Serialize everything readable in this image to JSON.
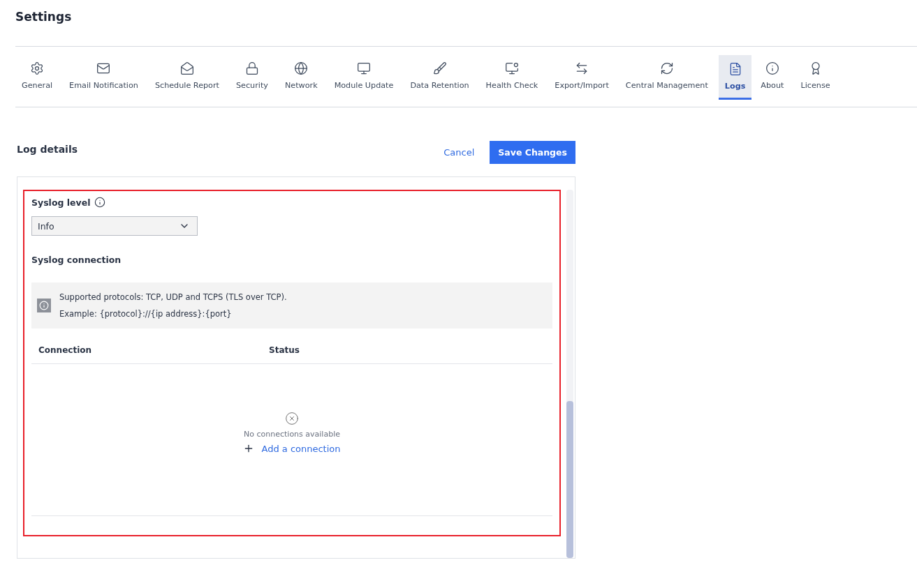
{
  "page": {
    "title": "Settings"
  },
  "tabs": [
    {
      "label": "General",
      "selected": false
    },
    {
      "label": "Email Notification",
      "selected": false
    },
    {
      "label": "Schedule Report",
      "selected": false
    },
    {
      "label": "Security",
      "selected": false
    },
    {
      "label": "Network",
      "selected": false
    },
    {
      "label": "Module Update",
      "selected": false
    },
    {
      "label": "Data Retention",
      "selected": false
    },
    {
      "label": "Health Check",
      "selected": false
    },
    {
      "label": "Export/Import",
      "selected": false
    },
    {
      "label": "Central Management",
      "selected": false
    },
    {
      "label": "Logs",
      "selected": true
    },
    {
      "label": "About",
      "selected": false
    },
    {
      "label": "License",
      "selected": false
    }
  ],
  "section": {
    "title": "Log details",
    "cancel": "Cancel",
    "save": "Save Changes"
  },
  "syslog_level": {
    "label": "Syslog level",
    "value": "Info"
  },
  "syslog_connection": {
    "label": "Syslog connection",
    "info": [
      "Supported protocols: TCP, UDP and TCPS (TLS over TCP).",
      "Example: {protocol}://{ip address}:{port}"
    ]
  },
  "table": {
    "columns": [
      "Connection",
      "Status"
    ],
    "empty_message": "No connections available",
    "add_link": "Add a connection"
  }
}
